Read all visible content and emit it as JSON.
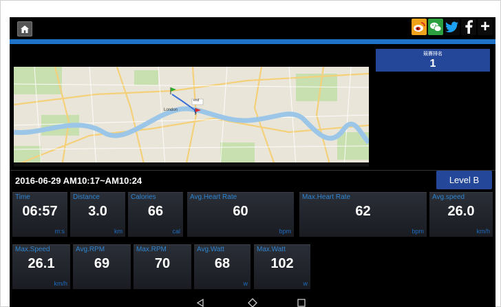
{
  "rank": {
    "label": "競賽排名",
    "value": "1"
  },
  "session": {
    "datetime": "2016-06-29 AM10:17~AM10:24",
    "level": "Level B"
  },
  "stats": [
    {
      "label": "Time",
      "value": "06:57",
      "unit": "m:s"
    },
    {
      "label": "Distance",
      "value": "3.0",
      "unit": "km"
    },
    {
      "label": "Calories",
      "value": "66",
      "unit": "cal"
    },
    {
      "label": "Avg.Heart Rate",
      "value": "60",
      "unit": "bpm"
    },
    {
      "label": "Max.Heart Rate",
      "value": "62",
      "unit": "bpm"
    },
    {
      "label": "Avg.speed",
      "value": "26.0",
      "unit": "km/h"
    },
    {
      "label": "Max.Speed",
      "value": "26.1",
      "unit": "km/h"
    },
    {
      "label": "Avg.RPM",
      "value": "69",
      "unit": ""
    },
    {
      "label": "Max.RPM",
      "value": "70",
      "unit": ""
    },
    {
      "label": "Avg.Watt",
      "value": "68",
      "unit": "w"
    },
    {
      "label": "Max.Watt",
      "value": "102",
      "unit": "w"
    }
  ],
  "map": {
    "city_label": "London",
    "route_label": "end"
  },
  "colors": {
    "accent_blue": "#1e73c8",
    "button_blue": "#24479a",
    "label_blue": "#2f86d3"
  },
  "icons": [
    "home-icon",
    "weibo-icon",
    "wechat-icon",
    "twitter-icon",
    "facebook-icon",
    "plus-icon",
    "back-icon",
    "home-nav-icon",
    "recents-icon"
  ]
}
